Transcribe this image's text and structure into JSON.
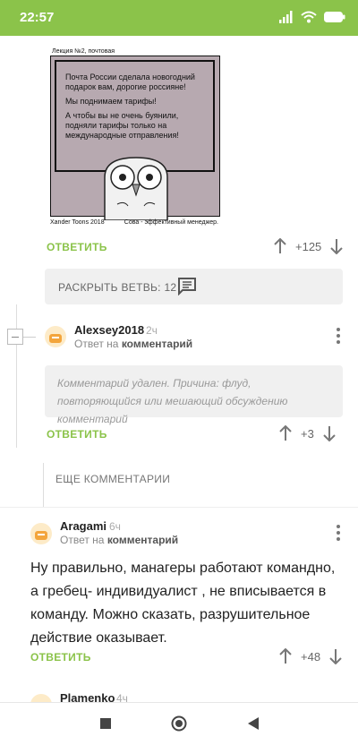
{
  "status_bar": {
    "time": "22:57",
    "battery_icon": "battery-icon",
    "wifi_icon": "wifi-icon",
    "signal_icon": "signal-icon"
  },
  "comic": {
    "header": "Лекция №2, почтовая",
    "lines": [
      "Почта России сделала новогодний подарок вам, дорогие россияне!",
      "Мы поднимаем тарифы!",
      "А чтобы вы не очень буянили, подняли тарифы только на международные отправления!"
    ],
    "footer_left": "Xander Toons 2018",
    "footer_right": "Сова - эффективный менеджер."
  },
  "comment_actions_1": {
    "reply": "ОТВЕТИТЬ",
    "score": "+125"
  },
  "expand_thread": {
    "label": "РАСКРЫТЬ ВЕТВЬ: 12"
  },
  "comment_2": {
    "username": "Alexsey2018",
    "time": "2ч",
    "reply_to_prefix": "Ответ на",
    "reply_to_target": "комментарий",
    "deleted_text": "Комментарий удален. Причина: флуд, повторяющийся или мешающий обсуждению комментарий",
    "reply": "ОТВЕТИТЬ",
    "score": "+3"
  },
  "more_comments": {
    "label": "ЕЩЕ КОММЕНТАРИИ"
  },
  "comment_3": {
    "username": "Aragami",
    "time": "6ч",
    "reply_to_prefix": "Ответ на",
    "reply_to_target": "комментарий",
    "text": "Ну правильно, манагеры работают командно, а гребец- индивидуалист , не вписывается в команду. Можно сказать, разрушительное действие оказывает.",
    "reply": "ОТВЕТИТЬ",
    "score": "+48"
  },
  "comment_4": {
    "username": "Plamenko",
    "time": "4ч"
  },
  "colors": {
    "accent": "#8bc34a",
    "muted": "#999999",
    "panel": "#f0f0f0"
  }
}
